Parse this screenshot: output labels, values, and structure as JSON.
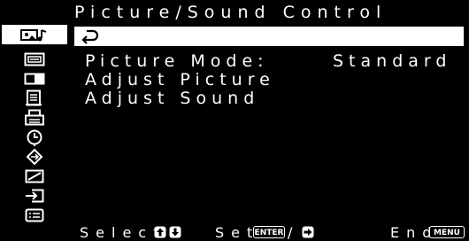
{
  "panel": {
    "title": "Picture/Sound Control",
    "items": [
      {
        "label": "Picture Mode:",
        "value": "Standard"
      },
      {
        "label": "Adjust Picture"
      },
      {
        "label": "Adjust Sound"
      }
    ]
  },
  "sidebar": {
    "icons": [
      "picture-sound-icon",
      "screen-icon",
      "dual-window-icon",
      "file-icon",
      "printer-icon",
      "clock-icon",
      "navigation-icon",
      "ramp-icon",
      "input-icon",
      "list-icon"
    ]
  },
  "footer": {
    "select_label": "Select",
    "set_label": "Set",
    "enter_key": "ENTER",
    "separator": "/",
    "end_label": "End",
    "menu_key": "MENU"
  },
  "colors": {
    "background": "#000000",
    "foreground": "#ffffff",
    "highlight": "#ffffff"
  }
}
